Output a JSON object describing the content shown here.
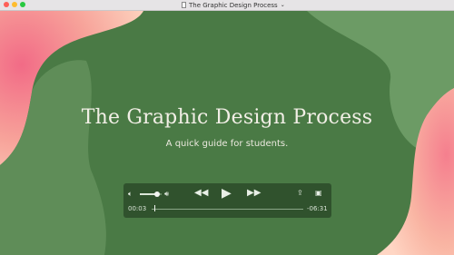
{
  "window": {
    "title": "The Graphic Design Process"
  },
  "slide": {
    "title": "The Graphic Design Process",
    "subtitle": "A quick guide for students."
  },
  "player": {
    "elapsed": "00:03",
    "remaining": "-06:31",
    "volume_fraction": 0.8,
    "progress_fraction": 0.02
  },
  "colors": {
    "background_green": "#4a7a45",
    "accent_pink": "#f57f8e",
    "accent_peach": "#ffd3c2"
  }
}
